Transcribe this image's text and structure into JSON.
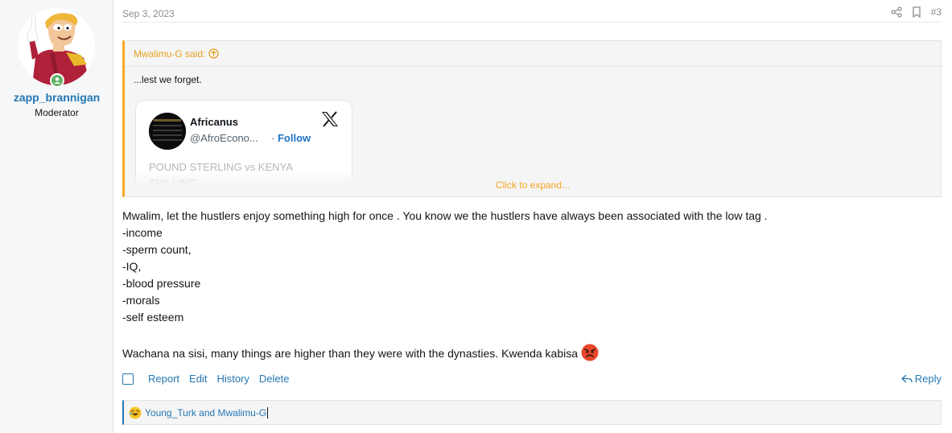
{
  "author": {
    "username": "zapp_brannigan",
    "title": "Moderator",
    "avatar_icon": "cartoon-avatar",
    "online_icon": "online-user-icon"
  },
  "post": {
    "date": "Sep 3, 2023",
    "number": "#3",
    "share_icon": "share-icon",
    "bookmark_icon": "bookmark-icon"
  },
  "quote": {
    "attribution": "Mwalimu-G said:",
    "body": "...lest we forget.",
    "expand_label": "Click to expand...",
    "tweet": {
      "name": "Africanus",
      "handle": "@AfroEcono...",
      "follow_sep": "·",
      "follow_label": "Follow",
      "text": "POUND STERLING vs KENYA SHILLING"
    }
  },
  "message": {
    "lines": [
      "Mwalim, let the hustlers enjoy something high for once . You know we the hustlers have always been associated with the low tag .",
      "-income",
      "-sperm count,",
      "-IQ,",
      "-blood pressure",
      "-morals",
      "-self esteem",
      "",
      "Wachana na sisi, many things are higher than they were with the dynasties. Kwenda kabisa"
    ],
    "emoji": "angry-face"
  },
  "actions": {
    "report": "Report",
    "edit": "Edit",
    "history": "History",
    "delete": "Delete",
    "reply": "Reply"
  },
  "reactions": {
    "icon": "laughing-emoji",
    "users": "Young_Turk and Mwalimu-G"
  },
  "colors": {
    "link": "#2577b1",
    "quote_accent": "#f9a825",
    "expand": "#f5a623"
  }
}
